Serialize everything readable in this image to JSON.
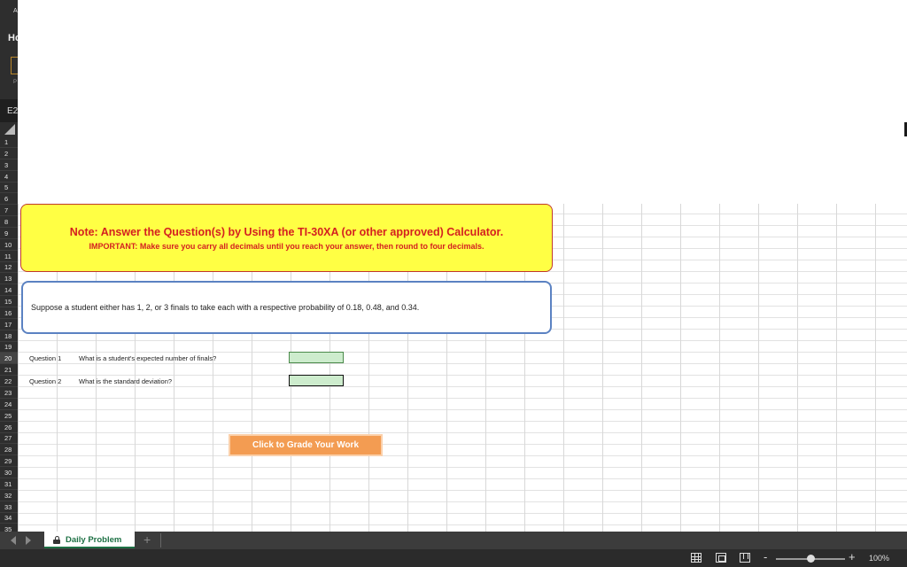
{
  "ribbon": {
    "app_fragment": "A",
    "home_fragment": "Hc",
    "paste_fragment": "P",
    "name_box": "E2"
  },
  "rows": [
    "1",
    "2",
    "3",
    "4",
    "5",
    "6",
    "7",
    "8",
    "9",
    "10",
    "11",
    "12",
    "13",
    "14",
    "15",
    "16",
    "17",
    "18",
    "19",
    "20",
    "21",
    "22",
    "23",
    "24",
    "25",
    "26",
    "27",
    "28",
    "29",
    "30",
    "31",
    "32",
    "33",
    "34",
    "35"
  ],
  "note": {
    "title": "Note: Answer the Question(s) by Using the TI-30XA (or other approved) Calculator.",
    "subtitle": "IMPORTANT: Make sure you carry all decimals until you reach your answer, then round to four decimals.",
    "background": "#ffff44",
    "text_color": "#d42020"
  },
  "problem": {
    "text": "Suppose a student either has 1, 2, or 3 finals to take each with a respective probability of 0.18, 0.48, and 0.34."
  },
  "questions": [
    {
      "label": "Question 1",
      "text": "What is a student's expected number of finals?",
      "answer": ""
    },
    {
      "label": "Question 2",
      "text": "What is the standard deviation?",
      "answer": ""
    }
  ],
  "grade_button": {
    "label": "Click to Grade Your Work",
    "color": "#f39c52"
  },
  "sheet_tabs": {
    "active": "Daily Problem",
    "add": "+"
  },
  "status_bar": {
    "zoom_minus": "-",
    "zoom_plus": "+",
    "zoom_level": "100%",
    "zoom_fraction": 0.5
  }
}
